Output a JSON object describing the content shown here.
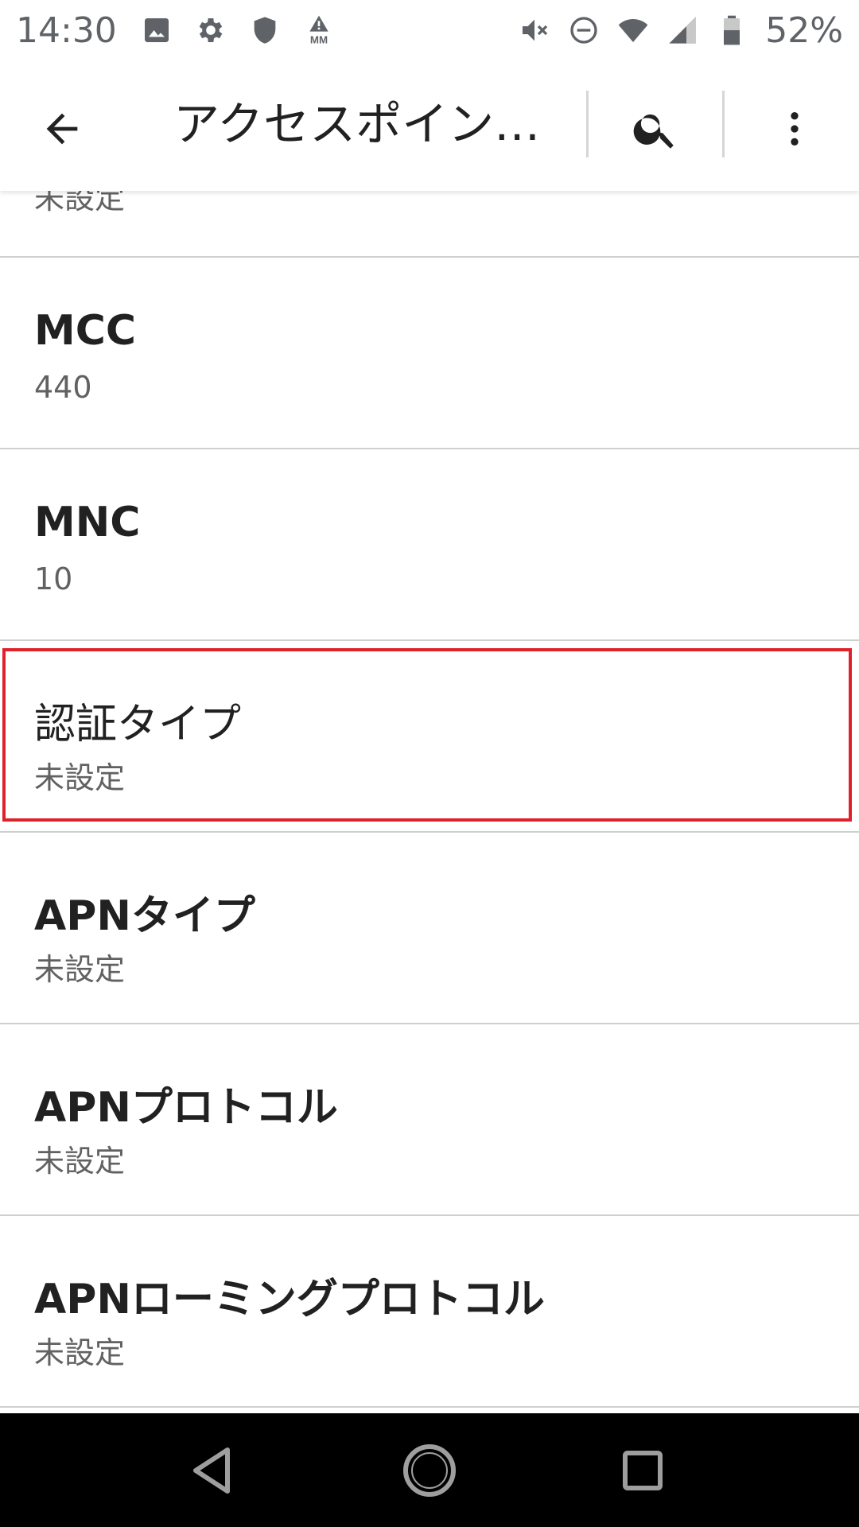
{
  "status_bar": {
    "time": "14:30",
    "battery_percent": "52%",
    "left_icons": [
      "gallery-icon",
      "settings-gear-icon",
      "shield-icon",
      "mm-warning-icon"
    ],
    "right_icons": [
      "mute-icon",
      "do-not-disturb-icon",
      "wifi-icon",
      "signal-icon",
      "battery-icon"
    ]
  },
  "app_bar": {
    "title": "アクセスポイン…",
    "back_icon": "arrow-back-icon",
    "search_icon": "search-icon",
    "more_icon": "more-vert-icon"
  },
  "list": {
    "partial_top_summary": "未設定",
    "items": [
      {
        "title": "MCC",
        "summary": "440"
      },
      {
        "title": "MNC",
        "summary": "10"
      },
      {
        "title": "認証タイプ",
        "summary": "未設定",
        "highlighted": true
      },
      {
        "title": "APNタイプ",
        "summary": "未設定"
      },
      {
        "title": "APNプロトコル",
        "summary": "未設定"
      },
      {
        "title": "APNローミングプロトコル",
        "summary": "未設定"
      }
    ]
  },
  "colors": {
    "highlight": "#e0202a",
    "nav_background": "#000000",
    "divider": "#cfcfcf"
  },
  "nav_bar": {
    "icons": [
      "nav-back-icon",
      "nav-home-icon",
      "nav-recents-icon"
    ]
  }
}
